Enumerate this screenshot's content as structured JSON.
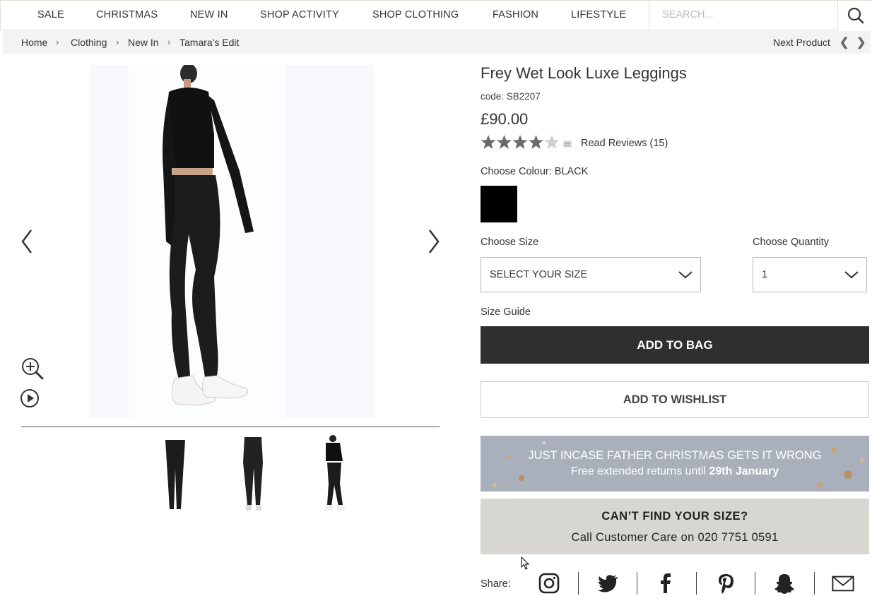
{
  "nav": {
    "items": [
      "SALE",
      "CHRISTMAS",
      "NEW IN",
      "SHOP ACTIVITY",
      "SHOP CLOTHING",
      "FASHION",
      "LIFESTYLE"
    ],
    "search_placeholder": "SEARCH..."
  },
  "breadcrumb": {
    "items": [
      "Home",
      "Clothing",
      "New In",
      "Tamara's Edit"
    ],
    "separator": "›",
    "next_product": "Next Product",
    "prev_arrow": "❮",
    "next_arrow": "❯"
  },
  "product": {
    "title": "Frey Wet Look Luxe Leggings",
    "code": "code: SB2207",
    "price": "£90.00",
    "rating": 4,
    "rating_max": 5,
    "reviews": "Read Reviews (15)",
    "colour_label": "Choose Colour: BLACK",
    "colour_swatch": "#000000",
    "size_label": "Choose Size",
    "size_value": "SELECT YOUR SIZE",
    "quantity_label": "Choose Quantity",
    "quantity_value": "1",
    "size_guide": "Size Guide",
    "add_to_bag": "ADD TO BAG",
    "add_to_wishlist": "ADD TO WISHLIST"
  },
  "promo": {
    "line1": "JUST INCASE FATHER CHRISTMAS GETS IT WRONG",
    "line2_prefix": "Free extended returns until",
    "line2_bold": "29th January"
  },
  "help": {
    "line1": "CAN’T FIND YOUR SIZE?",
    "line2": "Call Customer Care on 020 7751 0591"
  },
  "share": {
    "label": "Share:",
    "icons": [
      "instagram-icon",
      "twitter-icon",
      "facebook-icon",
      "pinterest-icon",
      "snapchat-icon",
      "email-icon"
    ]
  },
  "colors": {
    "button_dark": "#2f2f30",
    "promo_bg": "#a9b0bb",
    "help_bg": "#d7d6d1"
  }
}
